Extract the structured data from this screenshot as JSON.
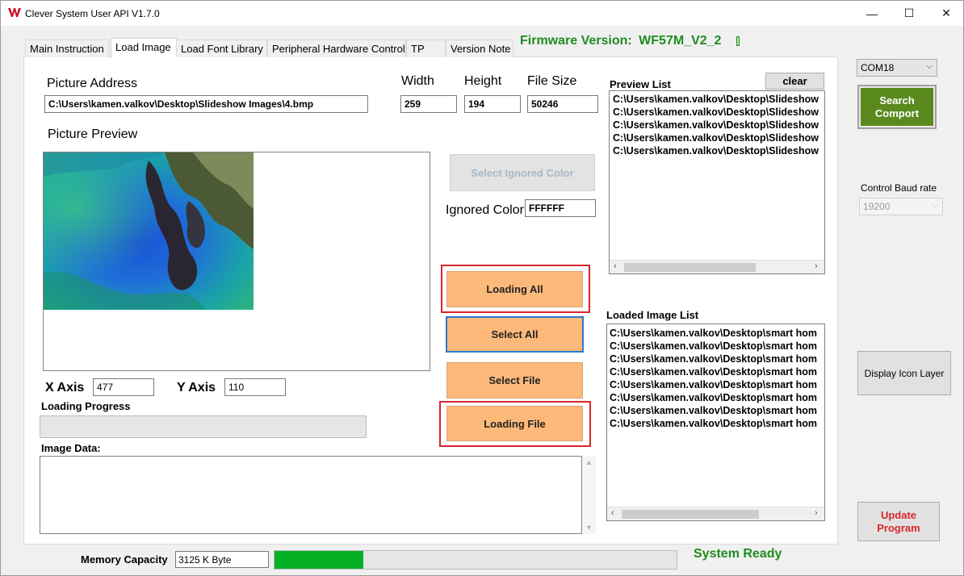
{
  "window": {
    "title": "Clever System User API V1.7.0",
    "minimize_glyph": "—",
    "maximize_glyph": "☐",
    "close_glyph": "✕"
  },
  "tabs": [
    {
      "label": "Main Instruction",
      "active": false
    },
    {
      "label": "Load Image",
      "active": true
    },
    {
      "label": "Load Font Library",
      "active": false
    },
    {
      "label": "Peripheral Hardware Control",
      "active": false
    },
    {
      "label": "TP",
      "active": false
    },
    {
      "label": "Version Note",
      "active": false
    }
  ],
  "firmware": {
    "label": "Firmware Version:",
    "value": "WF57M_V2_2"
  },
  "picture": {
    "address_label": "Picture Address",
    "address_value": "C:\\Users\\kamen.valkov\\Desktop\\Slideshow Images\\4.bmp",
    "width_label": "Width",
    "width_value": "259",
    "height_label": "Height",
    "height_value": "194",
    "filesize_label": "File Size",
    "filesize_value": "50246",
    "preview_label": "Picture Preview",
    "x_axis_label": "X Axis",
    "x_axis_value": "477",
    "y_axis_label": "Y Axis",
    "y_axis_value": "110"
  },
  "ignored_color": {
    "button_label": "Select Ignored Color",
    "label": "Ignored Color",
    "value": "FFFFFF"
  },
  "buttons": {
    "loading_all": "Loading All",
    "select_all": "Select All",
    "select_file": "Select File",
    "loading_file": "Loading File",
    "clear": "clear",
    "search_comport": "Search Comport",
    "display_icon_layer": "Display Icon Layer",
    "update_program": "Update Program"
  },
  "loading_progress": {
    "label": "Loading Progress",
    "value": 0
  },
  "image_data": {
    "label": "Image Data:"
  },
  "preview_list": {
    "label": "Preview List",
    "items": [
      "C:\\Users\\kamen.valkov\\Desktop\\Slideshow",
      "C:\\Users\\kamen.valkov\\Desktop\\Slideshow",
      "C:\\Users\\kamen.valkov\\Desktop\\Slideshow",
      "C:\\Users\\kamen.valkov\\Desktop\\Slideshow",
      "C:\\Users\\kamen.valkov\\Desktop\\Slideshow"
    ]
  },
  "loaded_list": {
    "label": "Loaded Image List",
    "items": [
      "C:\\Users\\kamen.valkov\\Desktop\\smart hom",
      "C:\\Users\\kamen.valkov\\Desktop\\smart hom",
      "C:\\Users\\kamen.valkov\\Desktop\\smart hom",
      "C:\\Users\\kamen.valkov\\Desktop\\smart hom",
      "C:\\Users\\kamen.valkov\\Desktop\\smart hom",
      "C:\\Users\\kamen.valkov\\Desktop\\smart hom",
      "C:\\Users\\kamen.valkov\\Desktop\\smart hom",
      "C:\\Users\\kamen.valkov\\Desktop\\smart hom"
    ]
  },
  "com": {
    "port": "COM18",
    "baud_label": "Control Baud rate",
    "baud_value": "19200"
  },
  "status": {
    "memory_label": "Memory Capacity",
    "memory_value": "3125 K Byte",
    "memory_fill_fraction": 0.22,
    "system_status": "System Ready"
  },
  "colors": {
    "orange": "#fdb97a",
    "green_status": "#1f8c1f",
    "progress_green": "#06b025",
    "comport_green": "#5a8a1e",
    "update_red": "#d9262b"
  }
}
